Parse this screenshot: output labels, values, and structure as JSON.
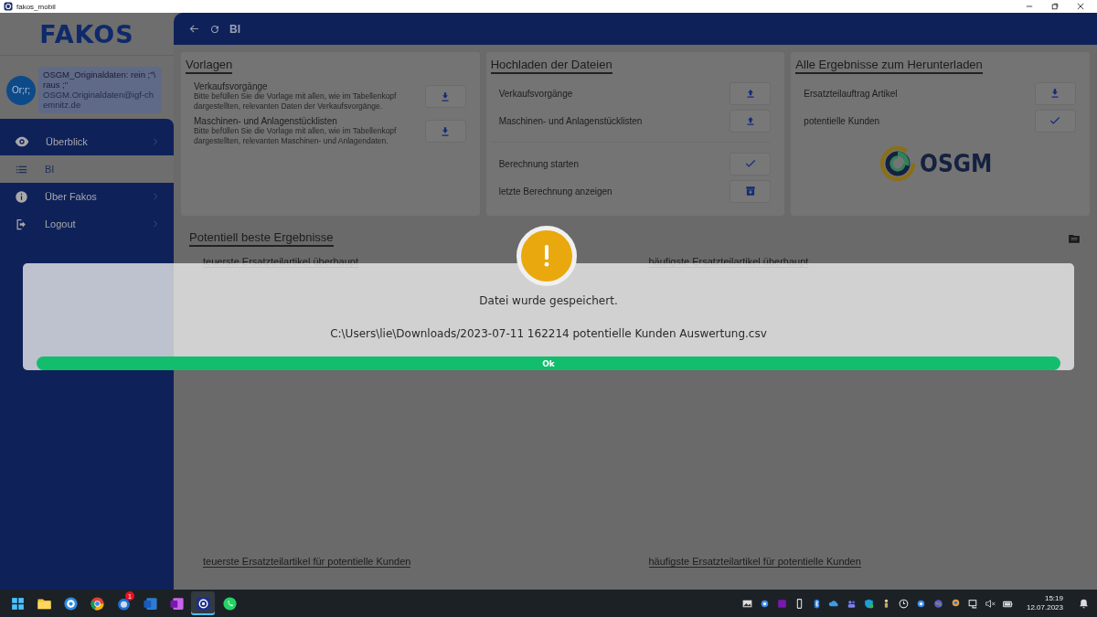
{
  "window": {
    "title": "fakos_mobil"
  },
  "sidebar": {
    "logo": "FAKOS",
    "user": {
      "initials": "Or;r;",
      "name": "OSGM_Originaldaten: rein ;\"\\ raus ;\"",
      "email": "OSGM.Originaldaten@igf-chemnitz.de"
    },
    "items": [
      {
        "kind": "eye",
        "label": "Überblick",
        "selected": false
      },
      {
        "kind": "list",
        "label": "BI",
        "selected": true
      },
      {
        "kind": "info",
        "label": "Über Fakos",
        "selected": false
      },
      {
        "kind": "logout",
        "label": "Logout",
        "selected": false
      }
    ]
  },
  "header": {
    "title": "BI"
  },
  "cards": [
    {
      "title": "Vorlagen",
      "rows": [
        {
          "kind": "described",
          "label": "Verkaufsvorgänge",
          "description": "Bitte befüllen Sie die Vorlage mit allen, wie im Tabellenkopf dargestellten, relevanten Daten der Verkaufsvorgänge.",
          "button": {
            "kind": "download"
          }
        },
        {
          "kind": "described",
          "label": "Maschinen- und Anlagenstücklisten",
          "description": "Bitte befüllen Sie die Vorlage mit allen, wie im Tabellenkopf dargestellten, relevanten Maschinen- und Anlagendaten.",
          "button": {
            "kind": "download"
          }
        }
      ]
    },
    {
      "title": "Hochladen der Dateien",
      "rows": [
        {
          "kind": "plain",
          "label": "Verkaufsvorgänge",
          "button": {
            "kind": "upload"
          }
        },
        {
          "kind": "plain",
          "label": "Maschinen- und Anlagenstücklisten",
          "button": {
            "kind": "upload"
          }
        },
        {
          "kind": "divider"
        },
        {
          "kind": "plain",
          "label": "Berechnung starten",
          "button": {
            "kind": "check"
          }
        },
        {
          "kind": "plain",
          "label": "letzte Berechnung anzeigen",
          "button": {
            "kind": "archive"
          }
        }
      ]
    },
    {
      "title": "Alle Ergebnisse zum Herunterladen",
      "rows": [
        {
          "kind": "plain",
          "label": "Ersatzteilauftrag Artikel",
          "button": {
            "kind": "download"
          }
        },
        {
          "kind": "plain",
          "label": "potentielle Kunden",
          "button": {
            "kind": "check"
          }
        },
        {
          "kind": "logo",
          "label": "OSGM"
        }
      ]
    }
  ],
  "results": {
    "title": "Potentiell beste Ergebnisse",
    "links": [
      "teuerste Ersatzteilartikel überhaupt",
      "häufigste Ersatzteilartikel überhaupt",
      "teuerste Ersatzteilartikel für potentielle Kunden",
      "häufigste Ersatzteilartikel für potentielle Kunden"
    ]
  },
  "dialog": {
    "message": "Datei wurde gespeichert.",
    "path": "C:\\Users\\lie\\Downloads/2023-07-11 162214 potentielle Kunden Auswertung.csv",
    "button": "Ok"
  },
  "taskbar": {
    "apps": [
      {
        "kind": "start",
        "selected": false
      },
      {
        "kind": "folder",
        "selected": false
      },
      {
        "kind": "blue-app",
        "selected": false
      },
      {
        "kind": "browser",
        "selected": false
      },
      {
        "kind": "mail",
        "selected": false,
        "badge": "1"
      },
      {
        "kind": "word",
        "selected": false
      },
      {
        "kind": "onenote",
        "selected": false
      },
      {
        "kind": "fakos",
        "selected": true
      },
      {
        "kind": "whatsapp",
        "selected": false
      }
    ],
    "tray": [
      {
        "kind": "photo"
      },
      {
        "kind": "dot-app"
      },
      {
        "kind": "onenote"
      },
      {
        "kind": "usb"
      },
      {
        "kind": "bluetooth"
      },
      {
        "kind": "cloud"
      },
      {
        "kind": "teams"
      },
      {
        "kind": "shield"
      },
      {
        "kind": "figure"
      },
      {
        "kind": "clock"
      },
      {
        "kind": "dot-app"
      },
      {
        "kind": "globe"
      },
      {
        "kind": "pin"
      },
      {
        "kind": "network"
      },
      {
        "kind": "volume"
      },
      {
        "kind": "battery"
      }
    ],
    "time": "15:19",
    "date": "12.07.2023"
  }
}
